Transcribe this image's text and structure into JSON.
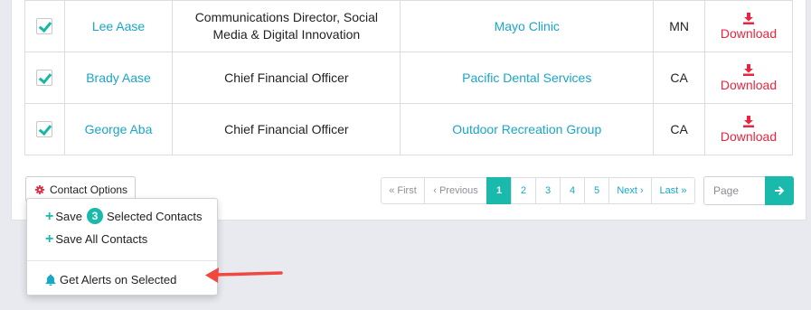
{
  "rows": [
    {
      "name": "Lee Aase",
      "title": "Communications Director, Social Media & Digital Innovation",
      "organization": "Mayo Clinic",
      "state": "MN",
      "action": "Download",
      "checked": true
    },
    {
      "name": "Brady Aase",
      "title": "Chief Financial Officer",
      "organization": "Pacific Dental Services",
      "state": "CA",
      "action": "Download",
      "checked": true
    },
    {
      "name": "George Aba",
      "title": "Chief Financial Officer",
      "organization": "Outdoor Recreation Group",
      "state": "CA",
      "action": "Download",
      "checked": true
    }
  ],
  "contact_options": {
    "label": "Contact Options",
    "icon": "gear-icon"
  },
  "pagination": {
    "first": "« First",
    "previous": "‹ Previous",
    "pages": [
      "1",
      "2",
      "3",
      "4",
      "5"
    ],
    "current": "1",
    "next": "Next ›",
    "last": "Last »",
    "page_placeholder": "Page"
  },
  "dropdown": {
    "save_selected_prefix": "Save",
    "selected_count": "3",
    "save_selected_suffix": "Selected Contacts",
    "save_all": "Save All Contacts",
    "get_alerts": "Get Alerts on Selected"
  },
  "colors": {
    "accent": "#19b9ab",
    "link": "#1aa6c6",
    "download": "#e8253f",
    "annotation_arrow": "#f0483e"
  }
}
